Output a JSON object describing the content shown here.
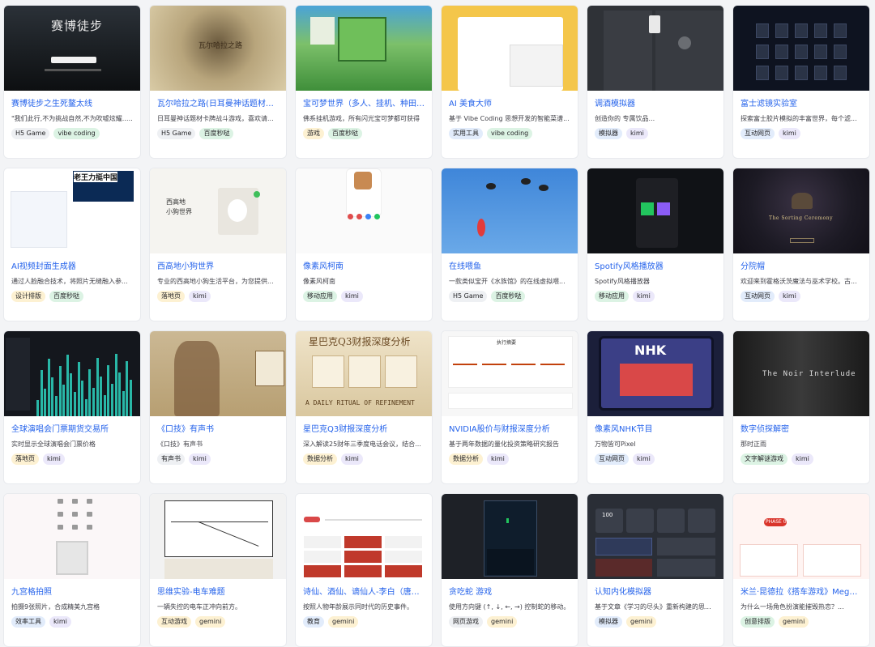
{
  "cards": [
    {
      "title": "赛博徒步之生死鳌太线",
      "desc": "\"我们此行,不为挑战自然,不为吹嘘炫耀......",
      "tags": [
        "H5 Game",
        "vibe coding"
      ],
      "thumb_text": "赛博徒步"
    },
    {
      "title": "瓦尔哈拉之路(日耳曼神话题材卡牌",
      "desc": "日耳曼神话题材卡牌战斗游戏，喜欢请...",
      "tags": [
        "H5 Game",
        "百度秒哒"
      ],
      "thumb_text": "瓦尔哈拉之路"
    },
    {
      "title": "宝可梦世界（多人、挂机、种田、交",
      "desc": "佛系挂机游戏，所有闪光宝可梦都可获得",
      "tags": [
        "游戏",
        "百度秒哒"
      ],
      "thumb_text": ""
    },
    {
      "title": "AI 美食大师",
      "desc": "基于 Vibe Coding 思想开发的智能菜谱...",
      "tags": [
        "实用工具",
        "vibe coding"
      ],
      "thumb_text": ""
    },
    {
      "title": "调酒模拟器",
      "desc": "创造你的 专属饮品...",
      "tags": [
        "模拟器",
        "kimi"
      ],
      "thumb_text": ""
    },
    {
      "title": "富士滤镜实验室",
      "desc": "探索富士胶片模拟的丰富世界，每个滤...",
      "tags": [
        "互动网页",
        "kimi"
      ],
      "thumb_text": ""
    },
    {
      "title": "AI视频封面生成器",
      "desc": "通过人脸融合技术，将照片无缝融入参...",
      "tags": [
        "设计排版",
        "百度秒哒"
      ],
      "thumb_text": "老王力挺中国"
    },
    {
      "title": "西高地小狗世界",
      "desc": "专业的西高地小狗生活平台，为您提供...",
      "tags": [
        "落地页",
        "kimi"
      ],
      "thumb_text": "西高地\n小狗世界"
    },
    {
      "title": "像素风柯南",
      "desc": "像素风柯南",
      "tags": [
        "移动应用",
        "kimi"
      ],
      "thumb_text": ""
    },
    {
      "title": "在线喂鱼",
      "desc": "一款类似宝开《水族馆》的在线虚拟喂...",
      "tags": [
        "H5 Game",
        "百度秒哒"
      ],
      "thumb_text": ""
    },
    {
      "title": "Spotify风格播放器",
      "desc": "Spotify风格播放器",
      "tags": [
        "移动应用",
        "kimi"
      ],
      "thumb_text": ""
    },
    {
      "title": "分院帽",
      "desc": "欢迎来到霍格沃茨魔法与巫术学校。古...",
      "tags": [
        "互动网页",
        "kimi"
      ],
      "thumb_text": "The Sorting Ceremony"
    },
    {
      "title": "全球演唱会门票期货交易所",
      "desc": "实时显示全球演唱会门票价格",
      "tags": [
        "落地页",
        "kimi"
      ],
      "thumb_text": ""
    },
    {
      "title": "《口技》有声书",
      "desc": "《口技》有声书",
      "tags": [
        "有声书",
        "kimi"
      ],
      "thumb_text": ""
    },
    {
      "title": "星巴克Q3财报深度分析",
      "desc": "深入解读25财年三季度电话会议，结合...",
      "tags": [
        "数据分析",
        "kimi"
      ],
      "thumb_text": "A DAILY RITUAL OF REFINEMENT"
    },
    {
      "title": "NVIDIA股价与财报深度分析",
      "desc": "基于两年数据的量化投资策略研究报告",
      "tags": [
        "数据分析",
        "kimi"
      ],
      "thumb_text": "执行摘要"
    },
    {
      "title": "像素风NHK节目",
      "desc": "万物皆可Pixel",
      "tags": [
        "互动网页",
        "kimi"
      ],
      "thumb_text": "NHK"
    },
    {
      "title": "数字侦探解密",
      "desc": "那时正雨",
      "tags": [
        "文字解谜游戏",
        "kimi"
      ],
      "thumb_text": "The Noir Interlude"
    },
    {
      "title": "九宫格拍照",
      "desc": "拍摄9张照片，合成精美九宫格",
      "tags": [
        "效率工具",
        "kimi"
      ],
      "thumb_text": ""
    },
    {
      "title": "思维实验-电车难题",
      "desc": "一辆失控的电车正冲向前方。",
      "tags": [
        "互动游戏",
        "gemini"
      ],
      "thumb_text": ""
    },
    {
      "title": "诗仙、酒仙、谪仙人-李白（唐朝）...",
      "desc": "按照人物年龄展示同时代的历史事件。",
      "tags": [
        "教育",
        "gemini"
      ],
      "thumb_text": ""
    },
    {
      "title": "贪吃蛇 游戏",
      "desc": "使用方向键 (↑, ↓, ←, →) 控制蛇的移动。",
      "tags": [
        "网页游戏",
        "gemini"
      ],
      "thumb_text": ""
    },
    {
      "title": "认知内化模拟器",
      "desc": "基于文章《学习的尽头》重新构建的思...",
      "tags": [
        "模拟器",
        "gemini"
      ],
      "thumb_text": "100"
    },
    {
      "title": "米兰·昆德拉《搭车游戏》Megherib",
      "desc": "为什么一场角色扮演能摧毁热恋？...",
      "tags": [
        "创意排版",
        "gemini"
      ],
      "thumb_text": "PHASE 01"
    }
  ],
  "tag_colors": {
    "H5 Game": "gray",
    "vibe coding": "green",
    "百度秒哒": "green",
    "游戏": "yellow",
    "实用工具": "blue",
    "模拟器": "blue",
    "kimi": "purple",
    "互动网页": "blue",
    "设计排版": "yellow",
    "落地页": "yellow",
    "移动应用": "green",
    "有声书": "gray",
    "数据分析": "yellow",
    "文字解谜游戏": "green",
    "效率工具": "blue",
    "gemini": "yellow",
    "互动游戏": "yellow",
    "教育": "blue",
    "网页游戏": "gray",
    "创意排版": "green"
  }
}
